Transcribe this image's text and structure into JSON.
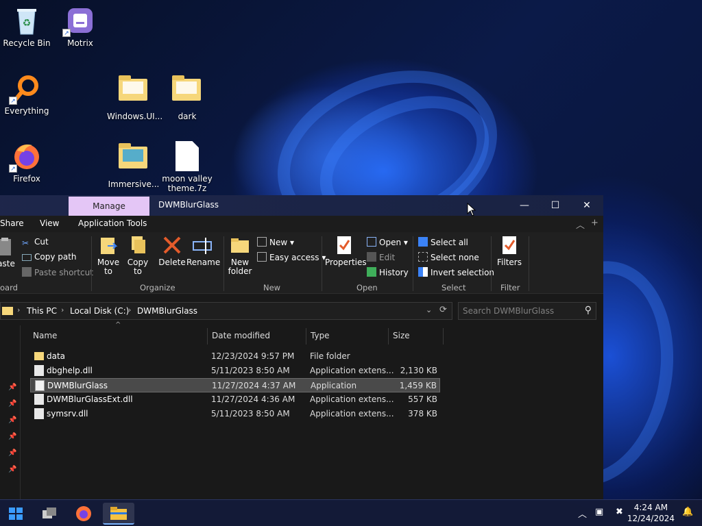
{
  "desktop": {
    "icons": [
      {
        "label": "Recycle Bin",
        "icon": "recycle-bin-icon"
      },
      {
        "label": "Motrix",
        "icon": "motrix-icon"
      },
      {
        "label": "Everything",
        "icon": "everything-icon"
      },
      {
        "label": "Windows.UI...",
        "icon": "folder-icon"
      },
      {
        "label": "dark",
        "icon": "folder-icon"
      },
      {
        "label": "Firefox",
        "icon": "firefox-icon"
      },
      {
        "label": "Immersive...",
        "icon": "folder-icon"
      },
      {
        "label": "moon valley theme.7z",
        "icon": "file-icon"
      }
    ]
  },
  "window": {
    "manage_tab": "Manage",
    "title": "DWMBlurGlass",
    "controls": {
      "minimize": "—",
      "maximize": "☐",
      "close": "✕"
    }
  },
  "ribbon_tabs": [
    "Share",
    "View",
    "Application Tools"
  ],
  "ribbon": {
    "clipboard": {
      "paste": "aste",
      "cut": "Cut",
      "copy_path": "Copy path",
      "paste_shortcut": "Paste shortcut",
      "label": "oard"
    },
    "organize": {
      "move_to": "Move to",
      "copy_to": "Copy to",
      "delete": "Delete",
      "rename": "Rename",
      "label": "Organize"
    },
    "new": {
      "new_folder": "New folder",
      "new_item": "New",
      "easy_access": "Easy access",
      "label": "New"
    },
    "open": {
      "properties": "Properties",
      "open": "Open",
      "edit": "Edit",
      "history": "History",
      "label": "Open"
    },
    "select": {
      "select_all": "Select all",
      "select_none": "Select none",
      "invert_selection": "Invert selection",
      "label": "Select"
    },
    "filter": {
      "filters": "Filters",
      "label": "Filter"
    }
  },
  "address": {
    "crumbs": [
      "This PC",
      "Local Disk (C:)",
      "DWMBlurGlass"
    ],
    "search_placeholder": "Search DWMBlurGlass"
  },
  "columns": [
    "Name",
    "Date modified",
    "Type",
    "Size"
  ],
  "files": [
    {
      "name": "data",
      "date": "12/23/2024 9:57 PM",
      "type": "File folder",
      "size": "",
      "kind": "folder"
    },
    {
      "name": "dbghelp.dll",
      "date": "5/11/2023 8:50 AM",
      "type": "Application extens...",
      "size": "2,130 KB",
      "kind": "dll"
    },
    {
      "name": "DWMBlurGlass",
      "date": "11/27/2024 4:37 AM",
      "type": "Application",
      "size": "1,459 KB",
      "kind": "exe",
      "selected": true
    },
    {
      "name": "DWMBlurGlassExt.dll",
      "date": "11/27/2024 4:36 AM",
      "type": "Application extens...",
      "size": "557 KB",
      "kind": "dll"
    },
    {
      "name": "symsrv.dll",
      "date": "5/11/2023 8:50 AM",
      "type": "Application extens...",
      "size": "378 KB",
      "kind": "dll"
    }
  ],
  "taskbar": {
    "clock_time": "4:24 AM",
    "clock_date": "12/24/2024"
  }
}
